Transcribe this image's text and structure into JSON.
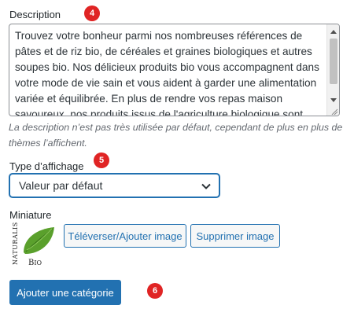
{
  "description": {
    "label": "Description",
    "step_badge": "4",
    "text": "Trouvez votre bonheur parmi nos nombreuses références de pâtes et de riz bio, de céréales et graines biologiques et autres soupes bio. Nos délicieux produits bio vous accompagnent dans votre mode de vie sain et vous aident à garder une alimentation variée et équilibrée. En plus de rendre vos repas maison savoureux, nos produits issus de l'agriculture biologique sont",
    "hint": "La description n’est pas très utilisée par défaut, cependant de plus en plus de thèmes l’affichent."
  },
  "display_type": {
    "label": "Type d’affichage",
    "step_badge": "5",
    "selected": "Valeur par défaut"
  },
  "thumbnail": {
    "label": "Miniature",
    "logo_text_brand": "NATURALIS",
    "logo_text_bio": "BIO",
    "upload_label": "Téléverser/Ajouter image",
    "remove_label": "Supprimer image"
  },
  "submit": {
    "label": "Ajouter une catégorie",
    "step_badge": "6"
  },
  "colors": {
    "accent": "#2271b1",
    "badge": "#e02424",
    "leaf": "#5aa02c"
  }
}
